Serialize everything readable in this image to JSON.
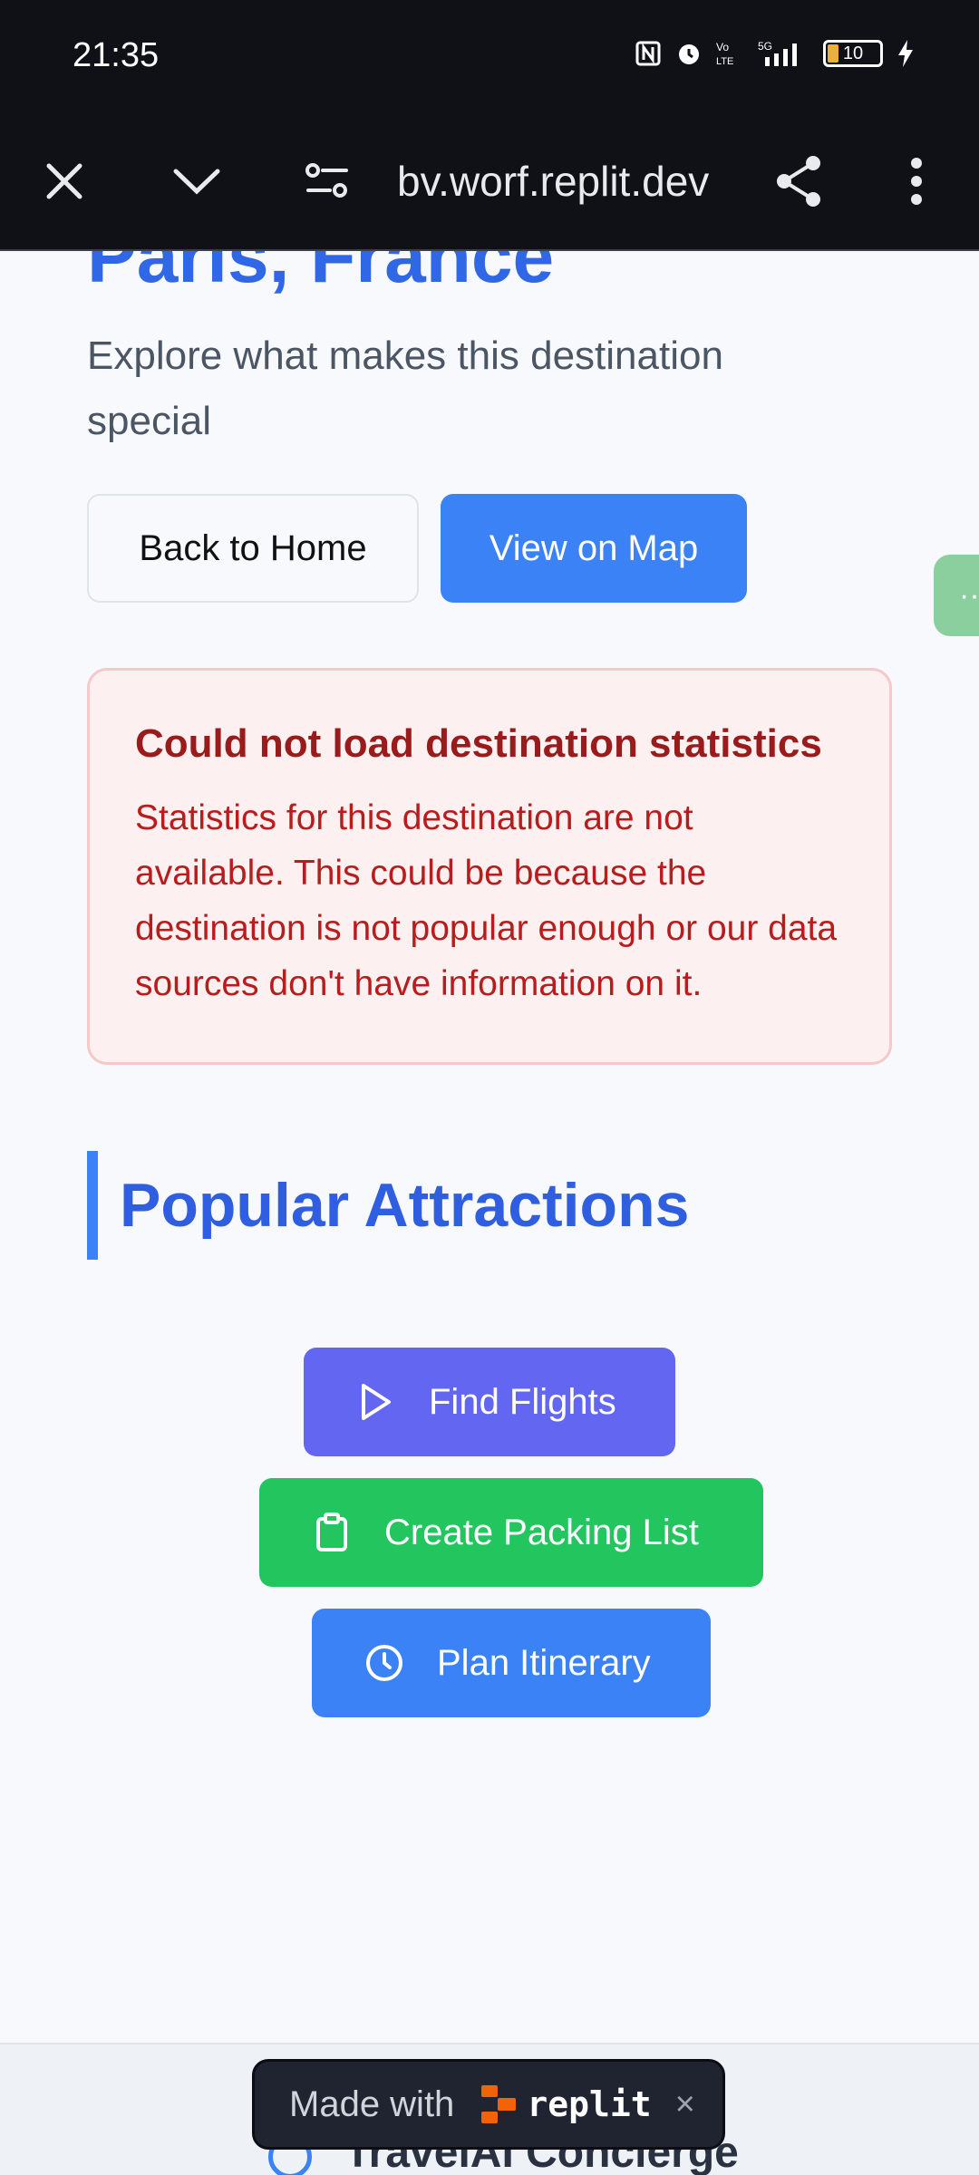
{
  "status_bar": {
    "time": "21:35",
    "icons": [
      "nfc-icon",
      "alarm-icon",
      "volte-icon",
      "5g-signal-icon"
    ],
    "battery": "10"
  },
  "browser": {
    "url": "bv.worf.replit.dev",
    "buttons": [
      "close-icon",
      "chevron-down-icon",
      "site-settings-icon",
      "share-icon",
      "more-icon"
    ]
  },
  "page": {
    "title": "Paris, France",
    "subtitle": "Explore what makes this destination special",
    "back_button": "Back to Home",
    "map_button": "View on Map"
  },
  "alert": {
    "title": "Could not load destination statistics",
    "body": "Statistics for this destination are not available. This could be because the destination is not popular enough or our data sources don't have information on it."
  },
  "section": {
    "title": "Popular Attractions"
  },
  "actions": {
    "flights": "Find Flights",
    "packing": "Create Packing List",
    "itinerary": "Plan Itinerary"
  },
  "footer": {
    "app_name": "TravelAI Concierge"
  },
  "badge": {
    "prefix": "Made with",
    "brand": "replit",
    "close": "×"
  },
  "colors": {
    "accent": "#3b82f6",
    "flights": "#6366f1",
    "packing": "#22c55e",
    "error_text": "#991b1b",
    "error_bg": "#fdf0f0"
  }
}
